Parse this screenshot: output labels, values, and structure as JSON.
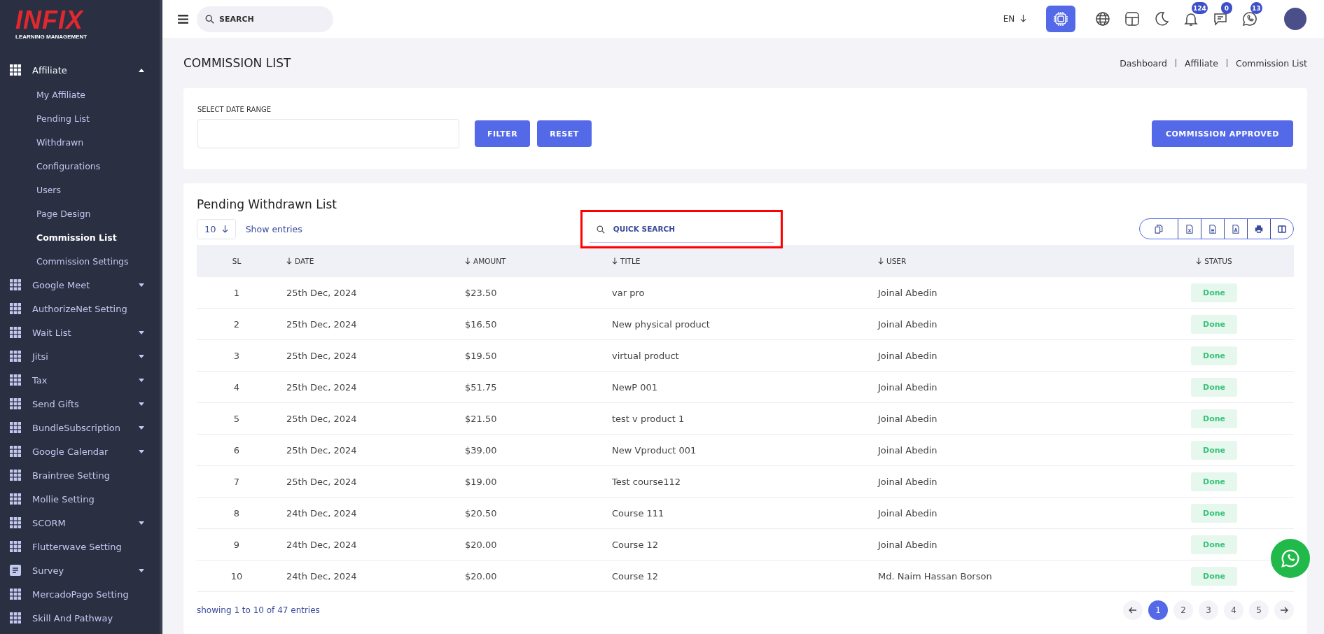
{
  "logo": {
    "brand": "INFIX",
    "tagline": "LEARNING MANAGEMENT"
  },
  "sidebar": {
    "items": [
      {
        "label": "Affiliate",
        "kind": "group",
        "expanded": true,
        "children": [
          {
            "label": "My Affiliate",
            "selected": false
          },
          {
            "label": "Pending List",
            "selected": false
          },
          {
            "label": "Withdrawn",
            "selected": false
          },
          {
            "label": "Configurations",
            "selected": false
          },
          {
            "label": "Users",
            "selected": false
          },
          {
            "label": "Page Design",
            "selected": false
          },
          {
            "label": "Commission List",
            "selected": true
          },
          {
            "label": "Commission Settings",
            "selected": false
          }
        ]
      },
      {
        "label": "Google Meet",
        "kind": "group",
        "expanded": false
      },
      {
        "label": "AuthorizeNet Setting",
        "kind": "link"
      },
      {
        "label": "Wait List",
        "kind": "group",
        "expanded": false
      },
      {
        "label": "Jitsi",
        "kind": "group",
        "expanded": false
      },
      {
        "label": "Tax",
        "kind": "group",
        "expanded": false
      },
      {
        "label": "Send Gifts",
        "kind": "group",
        "expanded": false
      },
      {
        "label": "BundleSubscription",
        "kind": "group",
        "expanded": false
      },
      {
        "label": "Google Calendar",
        "kind": "group",
        "expanded": false
      },
      {
        "label": "Braintree Setting",
        "kind": "link"
      },
      {
        "label": "Mollie Setting",
        "kind": "link"
      },
      {
        "label": "SCORM",
        "kind": "group",
        "expanded": false
      },
      {
        "label": "Flutterwave Setting",
        "kind": "link"
      },
      {
        "label": "Survey",
        "kind": "group",
        "expanded": false
      },
      {
        "label": "MercadoPago Setting",
        "kind": "link"
      },
      {
        "label": "Skill And Pathway",
        "kind": "link"
      }
    ]
  },
  "topbar": {
    "search": {
      "placeholder": "SEARCH"
    },
    "language": "EN",
    "badges": [
      {
        "count": "124"
      },
      {
        "count": "0"
      },
      {
        "count": "13"
      }
    ]
  },
  "page": {
    "title": "COMMISSION LIST",
    "breadcrumb": [
      "Dashboard",
      "Affiliate",
      "Commission List"
    ]
  },
  "filter": {
    "label": "SELECT DATE RANGE",
    "buttons": [
      "FILTER",
      "RESET"
    ],
    "approve_button": "COMMISSION APPROVED"
  },
  "table_card": {
    "title": "Pending Withdrawn List",
    "page_size": "10",
    "page_size_label": "Show entries",
    "quick_search": {
      "placeholder": "QUICK SEARCH",
      "highlighted": true
    },
    "columns": [
      {
        "label": "SL",
        "sortable": false
      },
      {
        "label": "DATE",
        "sortable": true
      },
      {
        "label": "AMOUNT",
        "sortable": true
      },
      {
        "label": "TITLE",
        "sortable": true
      },
      {
        "label": "USER",
        "sortable": true
      },
      {
        "label": "STATUS",
        "sortable": true
      }
    ],
    "rows": [
      [
        "1",
        "25th Dec, 2024",
        "$23.50",
        "var pro",
        "Joinal Abedin",
        "Done"
      ],
      [
        "2",
        "25th Dec, 2024",
        "$16.50",
        "New physical product",
        "Joinal Abedin",
        "Done"
      ],
      [
        "3",
        "25th Dec, 2024",
        "$19.50",
        "virtual product",
        "Joinal Abedin",
        "Done"
      ],
      [
        "4",
        "25th Dec, 2024",
        "$51.75",
        "NewP 001",
        "Joinal Abedin",
        "Done"
      ],
      [
        "5",
        "25th Dec, 2024",
        "$21.50",
        "test v product 1",
        "Joinal Abedin",
        "Done"
      ],
      [
        "6",
        "25th Dec, 2024",
        "$39.00",
        "New Vproduct 001",
        "Joinal Abedin",
        "Done"
      ],
      [
        "7",
        "25th Dec, 2024",
        "$19.00",
        "Test course112",
        "Joinal Abedin",
        "Done"
      ],
      [
        "8",
        "24th Dec, 2024",
        "$20.50",
        "Course 111",
        "Joinal Abedin",
        "Done"
      ],
      [
        "9",
        "24th Dec, 2024",
        "$20.00",
        "Course 12",
        "Joinal Abedin",
        "Done"
      ],
      [
        "10",
        "24th Dec, 2024",
        "$20.00",
        "Course 12",
        "Md. Naim Hassan Borson",
        "Done"
      ]
    ],
    "footer": "showing 1 to 10 of 47 entries",
    "pages": [
      {
        "label": "1",
        "selected": true
      },
      {
        "label": "2",
        "selected": false
      },
      {
        "label": "3",
        "selected": false
      },
      {
        "label": "4",
        "selected": false
      },
      {
        "label": "5",
        "selected": false
      }
    ]
  }
}
